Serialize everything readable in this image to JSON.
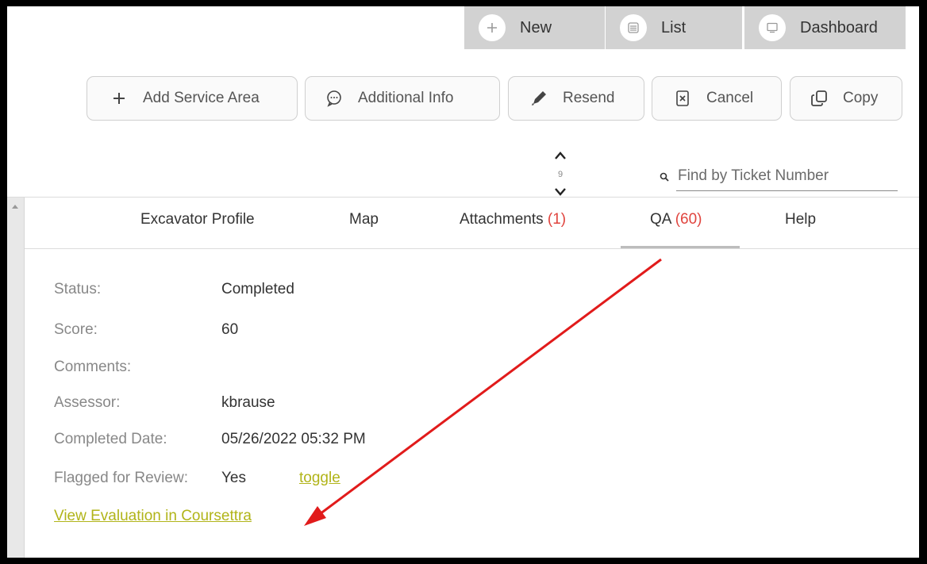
{
  "nav": {
    "new_label": "New",
    "list_label": "List",
    "dashboard_label": "Dashboard"
  },
  "toolbar": {
    "add_service_area": "Add Service Area",
    "additional_info": "Additional Info",
    "resend": "Resend",
    "cancel": "Cancel",
    "copy": "Copy"
  },
  "pager": {
    "count": "9"
  },
  "search": {
    "placeholder": "Find by Ticket Number"
  },
  "tabs": {
    "excavator_profile": "Excavator Profile",
    "map": "Map",
    "attachments": {
      "label": "Attachments ",
      "count": "(1)"
    },
    "qa": {
      "label": "QA ",
      "count": "(60)"
    },
    "help": "Help"
  },
  "details": {
    "status_label": "Status:",
    "status_value": "Completed",
    "score_label": "Score:",
    "score_value": "60",
    "comments_label": "Comments:",
    "assessor_label": "Assessor:",
    "assessor_value": "kbrause",
    "completed_label": "Completed Date:",
    "completed_value": "05/26/2022 05:32 PM",
    "flagged_label": "Flagged for Review:",
    "flagged_value": "Yes",
    "toggle_link": "toggle",
    "view_eval_link": "View Evaluation in Coursettra"
  },
  "colors": {
    "accent_red": "#e0443e",
    "link_olive": "#b1b419",
    "nav_gray": "#d2d2d2",
    "annotation_arrow": "#e11b1b"
  },
  "icons": {
    "new": "plus-icon",
    "list": "list-icon",
    "dashboard": "monitor-icon",
    "add_service_area": "plus-icon",
    "additional_info": "chat-bubble-icon",
    "resend": "pencil-icon",
    "cancel": "cancel-document-icon",
    "copy": "copy-icon",
    "search": "search-icon"
  }
}
